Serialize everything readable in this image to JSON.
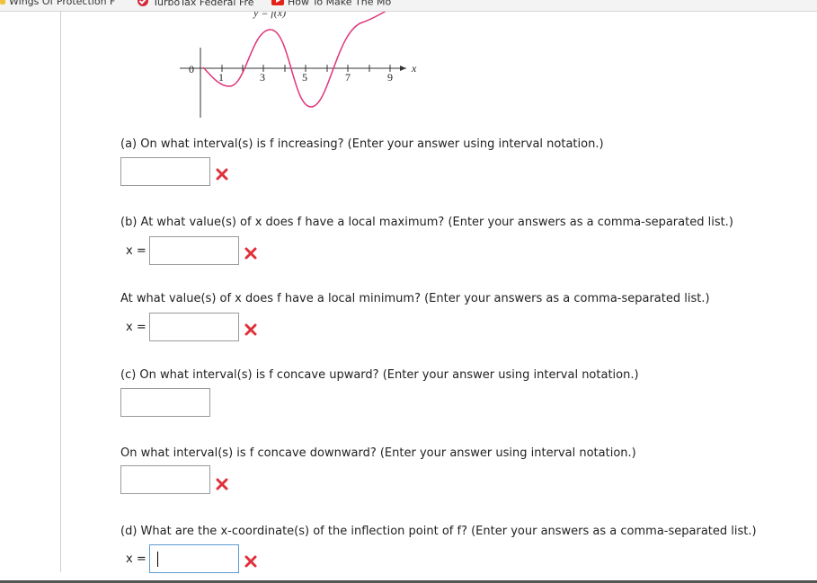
{
  "bookmarks": [
    {
      "label": "Wings Of Protection F",
      "icon": "bookmark-icon"
    },
    {
      "label": "TurboTax Federal Fre",
      "icon": "check-icon"
    },
    {
      "label": "How To Make The Mo",
      "icon": "youtube-icon"
    }
  ],
  "graph": {
    "title_fragment": "y = f(x)",
    "origin_label": "0",
    "x_ticks": [
      "1",
      "3",
      "5",
      "7",
      "9"
    ],
    "x_axis_label": "x",
    "curve_color": "#e0357a"
  },
  "questions": {
    "a": {
      "text": "(a) On what interval(s) is f increasing? (Enter your answer using interval notation.)",
      "value": "",
      "status": "incorrect"
    },
    "b1": {
      "text": "(b) At what value(s) of x does f have a local maximum? (Enter your answers as a comma-separated list.)",
      "prefix": "x =",
      "value": "",
      "status": "incorrect"
    },
    "b2": {
      "text": "At what value(s) of x does f have a local minimum? (Enter your answers as a comma-separated list.)",
      "prefix": "x =",
      "value": "",
      "status": "incorrect"
    },
    "c1": {
      "text": "(c) On what interval(s) is f concave upward? (Enter your answer using interval notation.)",
      "value": ""
    },
    "c2": {
      "text": "On what interval(s) is f concave downward? (Enter your answer using interval notation.)",
      "value": "",
      "status": "incorrect"
    },
    "d": {
      "text": "(d) What are the x-coordinate(s) of the inflection point of f? (Enter your answers as a comma-separated list.)",
      "prefix": "x =",
      "value": "",
      "status": "incorrect"
    }
  },
  "colors": {
    "incorrect": "#e0303a",
    "focus_border": "#5b9bd5"
  }
}
